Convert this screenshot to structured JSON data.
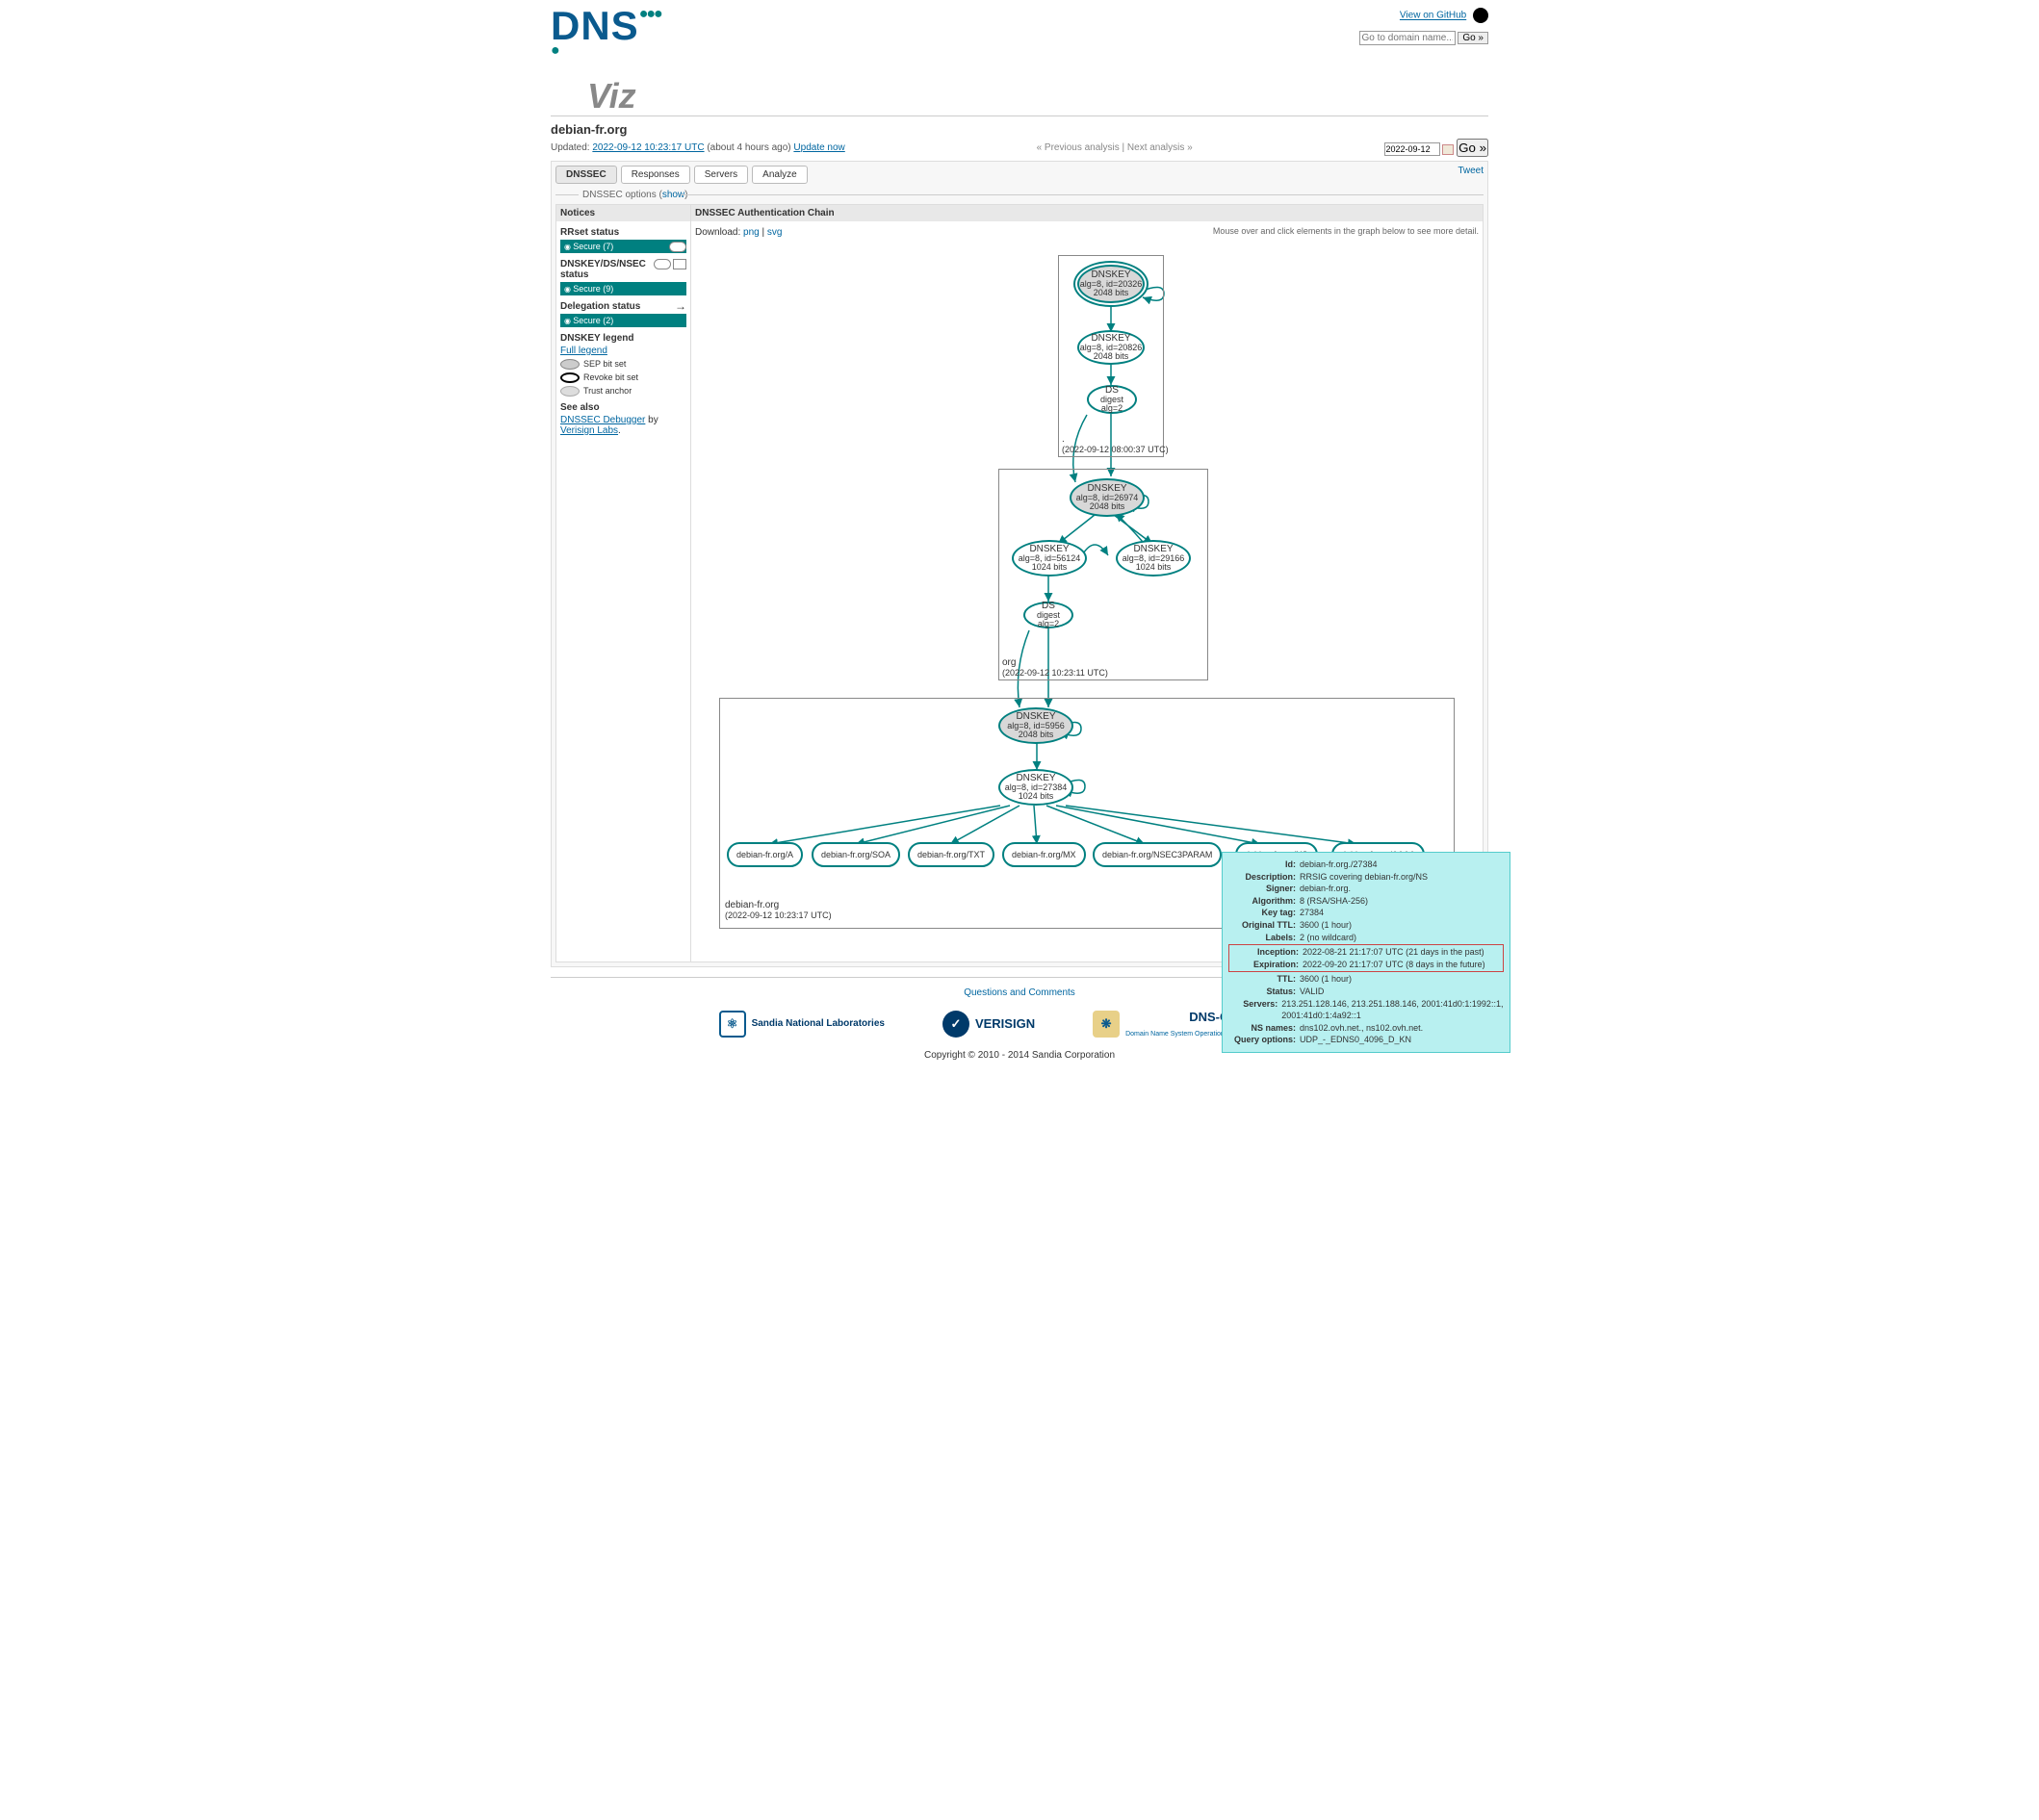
{
  "header": {
    "github_label": "View on GitHub",
    "search_placeholder": "Go to domain name...",
    "go_label": "Go »"
  },
  "domain": {
    "name": "debian-fr.org",
    "updated_label": "Updated:",
    "updated_time": "2022-09-12 10:23:17 UTC",
    "updated_rel": "(about 4 hours ago)",
    "update_now": "Update now"
  },
  "nav": {
    "prev": "« Previous analysis",
    "next": "Next analysis »",
    "date": "2022-09-12",
    "go": "Go »"
  },
  "tabs": [
    "DNSSEC",
    "Responses",
    "Servers",
    "Analyze"
  ],
  "tweet": "Tweet",
  "options": {
    "label": "DNSSEC options (",
    "show": "show",
    "close": ")"
  },
  "sidebar": {
    "notices": "Notices",
    "rrset_label": "RRset status",
    "rrset_status": "Secure (7)",
    "dnskey_label": "DNSKEY/DS/NSEC status",
    "dnskey_status": "Secure (9)",
    "deleg_label": "Delegation status",
    "deleg_status": "Secure (2)",
    "legend_label": "DNSKEY legend",
    "full_legend": "Full legend",
    "sep": "SEP bit set",
    "revoke": "Revoke bit set",
    "trust": "Trust anchor",
    "see_also": "See also",
    "debugger": "DNSSEC Debugger",
    "by": " by ",
    "vlabs": "Verisign Labs"
  },
  "main": {
    "title": "DNSSEC Authentication Chain",
    "download": "Download: ",
    "png": "png",
    "svg": "svg",
    "hint": "Mouse over and click elements in the graph below to see more detail."
  },
  "graph": {
    "root": {
      "ts": "(2022-09-12 08:00:37 UTC)",
      "label": ".",
      "k1": {
        "t": "DNSKEY",
        "l1": "alg=8, id=20326",
        "l2": "2048 bits"
      },
      "k2": {
        "t": "DNSKEY",
        "l1": "alg=8, id=20826",
        "l2": "2048 bits"
      },
      "ds": {
        "t": "DS",
        "l1": "digest alg=2"
      }
    },
    "org": {
      "label": "org",
      "ts": "(2022-09-12 10:23:11 UTC)",
      "k1": {
        "t": "DNSKEY",
        "l1": "alg=8, id=26974",
        "l2": "2048 bits"
      },
      "k2": {
        "t": "DNSKEY",
        "l1": "alg=8, id=56124",
        "l2": "1024 bits"
      },
      "k3": {
        "t": "DNSKEY",
        "l1": "alg=8, id=29166",
        "l2": "1024 bits"
      },
      "ds": {
        "t": "DS",
        "l1": "digest alg=2"
      }
    },
    "zone": {
      "label": "debian-fr.org",
      "ts": "(2022-09-12 10:23:17 UTC)",
      "k1": {
        "t": "DNSKEY",
        "l1": "alg=8, id=5956",
        "l2": "2048 bits"
      },
      "k2": {
        "t": "DNSKEY",
        "l1": "alg=8, id=27384",
        "l2": "1024 bits"
      },
      "rr": [
        "debian-fr.org/A",
        "debian-fr.org/SOA",
        "debian-fr.org/TXT",
        "debian-fr.org/MX",
        "debian-fr.org/NSEC3PARAM",
        "debian-fr.org/NS",
        "debian-fr.org/AAAA"
      ]
    }
  },
  "tooltip": {
    "id_k": "Id:",
    "id_v": "debian-fr.org./27384",
    "desc_k": "Description:",
    "desc_v": "RRSIG covering debian-fr.org/NS",
    "signer_k": "Signer:",
    "signer_v": "debian-fr.org.",
    "alg_k": "Algorithm:",
    "alg_v": "8 (RSA/SHA-256)",
    "kt_k": "Key tag:",
    "kt_v": "27384",
    "ottl_k": "Original TTL:",
    "ottl_v": "3600 (1 hour)",
    "lab_k": "Labels:",
    "lab_v": "2 (no wildcard)",
    "inc_k": "Inception:",
    "inc_v": "2022-08-21 21:17:07 UTC (21 days in the past)",
    "exp_k": "Expiration:",
    "exp_v": "2022-09-20 21:17:07 UTC (8 days in the future)",
    "ttl_k": "TTL:",
    "ttl_v": "3600 (1 hour)",
    "st_k": "Status:",
    "st_v": "VALID",
    "srv_k": "Servers:",
    "srv_v": "213.251.128.146, 213.251.188.146, 2001:41d0:1:1992::1, 2001:41d0:1:4a92::1",
    "ns_k": "NS names:",
    "ns_v": "dns102.ovh.net., ns102.ovh.net.",
    "qo_k": "Query options:",
    "qo_v": "UDP_-_EDNS0_4096_D_KN"
  },
  "footer": {
    "qc": "Questions and Comments",
    "sandia": "Sandia National Laboratories",
    "verisign": "VERISIGN",
    "oarc": "DNS-OARC",
    "oarc_sub": "Domain Name System Operations Analysis and Research Center",
    "copy": "Copyright © 2010 - 2014 Sandia Corporation"
  }
}
